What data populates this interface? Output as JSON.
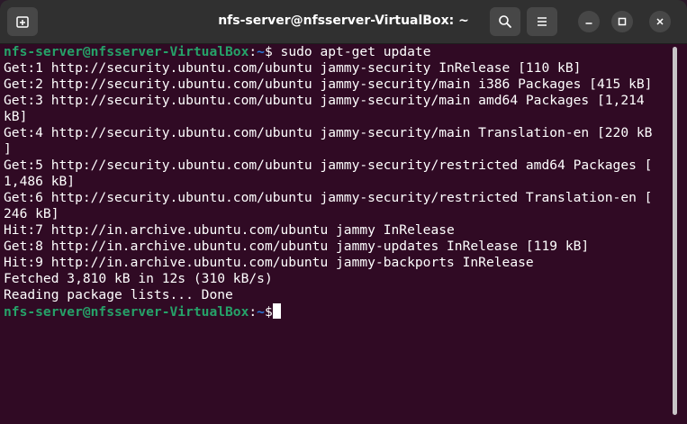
{
  "window": {
    "title": "nfs-server@nfsserver-VirtualBox: ~"
  },
  "header": {
    "new_tab_icon": "new-tab-icon",
    "search_icon": "search-icon",
    "menu_icon": "hamburger-menu-icon",
    "minimize_icon": "minimize-icon",
    "maximize_icon": "maximize-icon",
    "close_icon": "close-icon"
  },
  "prompt": {
    "user_host": "nfs-server@nfsserver-VirtualBox",
    "sep": ":",
    "path": "~",
    "symbol": "$"
  },
  "command": " sudo apt-get update",
  "output_lines": [
    "Get:1 http://security.ubuntu.com/ubuntu jammy-security InRelease [110 kB]",
    "Get:2 http://security.ubuntu.com/ubuntu jammy-security/main i386 Packages [415 kB]",
    "Get:3 http://security.ubuntu.com/ubuntu jammy-security/main amd64 Packages [1,214",
    "kB]",
    "Get:4 http://security.ubuntu.com/ubuntu jammy-security/main Translation-en [220 kB",
    "]",
    "Get:5 http://security.ubuntu.com/ubuntu jammy-security/restricted amd64 Packages [",
    "1,486 kB]",
    "Get:6 http://security.ubuntu.com/ubuntu jammy-security/restricted Translation-en [",
    "246 kB]",
    "Hit:7 http://in.archive.ubuntu.com/ubuntu jammy InRelease",
    "Get:8 http://in.archive.ubuntu.com/ubuntu jammy-updates InRelease [119 kB]",
    "Hit:9 http://in.archive.ubuntu.com/ubuntu jammy-backports InRelease",
    "Fetched 3,810 kB in 12s (310 kB/s)",
    "Reading package lists... Done"
  ],
  "colors": {
    "terminal_bg": "#300a24",
    "titlebar_bg": "#303030",
    "prompt_user": "#26a269",
    "prompt_path": "#2a7bde",
    "text": "#ffffff"
  }
}
